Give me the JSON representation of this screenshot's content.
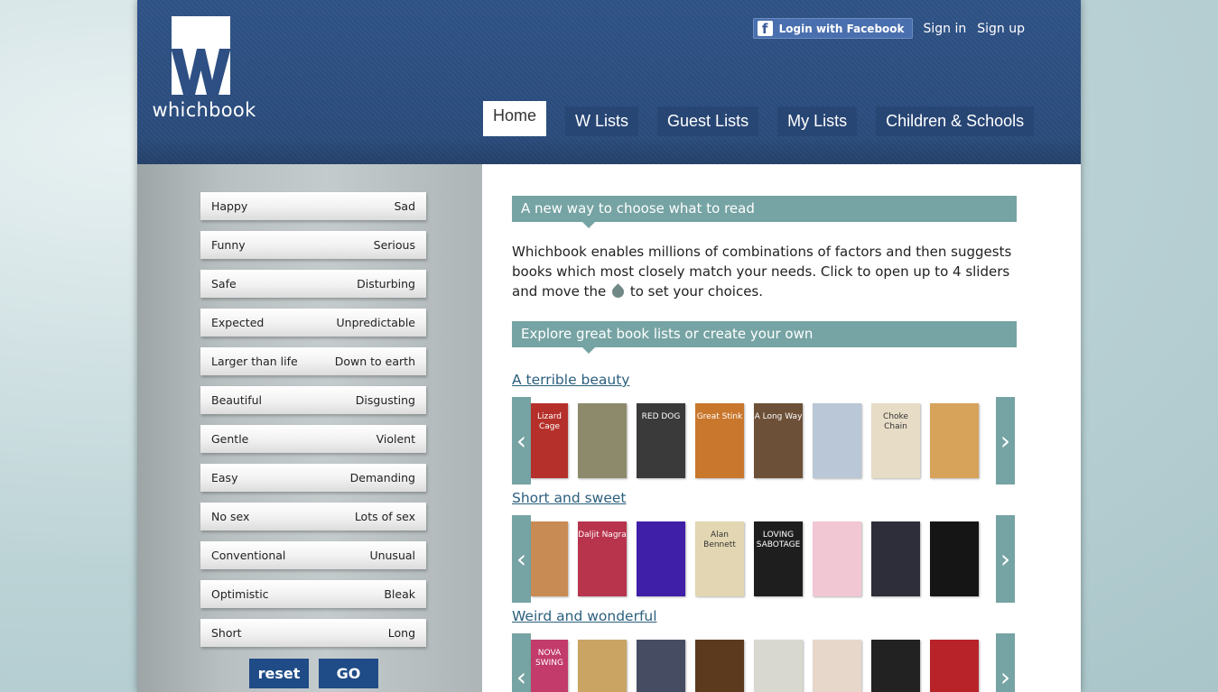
{
  "brand": {
    "name": "whichbook"
  },
  "auth": {
    "facebook": "Login with Facebook",
    "signin": "Sign in",
    "signup": "Sign up"
  },
  "nav": [
    {
      "label": "Home",
      "active": true
    },
    {
      "label": "W Lists"
    },
    {
      "label": "Guest Lists"
    },
    {
      "label": "My Lists"
    },
    {
      "label": "Children & Schools"
    }
  ],
  "sliders": [
    {
      "left": "Happy",
      "right": "Sad"
    },
    {
      "left": "Funny",
      "right": "Serious"
    },
    {
      "left": "Safe",
      "right": "Disturbing"
    },
    {
      "left": "Expected",
      "right": "Unpredictable"
    },
    {
      "left": "Larger than life",
      "right": "Down to earth"
    },
    {
      "left": "Beautiful",
      "right": "Disgusting"
    },
    {
      "left": "Gentle",
      "right": "Violent"
    },
    {
      "left": "Easy",
      "right": "Demanding"
    },
    {
      "left": "No sex",
      "right": "Lots of sex"
    },
    {
      "left": "Conventional",
      "right": "Unusual"
    },
    {
      "left": "Optimistic",
      "right": "Bleak"
    },
    {
      "left": "Short",
      "right": "Long"
    }
  ],
  "buttons": {
    "reset": "reset",
    "go": "GO"
  },
  "main": {
    "banner1": "A new way to choose what to read",
    "intro_before": "Whichbook enables millions of combinations of factors and then suggests books which most closely match your needs. Click to open up to 4 sliders and move the",
    "intro_after": "to set your choices.",
    "banner2": "Explore great book lists or create your own",
    "lists": [
      {
        "title": "A terrible beauty",
        "covers": [
          {
            "text": "Lizard Cage",
            "color": "#b5302a"
          },
          {
            "text": "",
            "color": "#8d8a6c"
          },
          {
            "text": "RED DOG",
            "color": "#3b3a3a"
          },
          {
            "text": "Great Stink",
            "color": "#c9772c"
          },
          {
            "text": "A Long Way",
            "color": "#6d5038"
          },
          {
            "text": "",
            "color": "#b9c7d6"
          },
          {
            "text": "Choke Chain",
            "color": "#e7dcc6"
          },
          {
            "text": "",
            "color": "#d7a25a"
          }
        ]
      },
      {
        "title": "Short and sweet",
        "covers": [
          {
            "text": "",
            "color": "#c98b54"
          },
          {
            "text": "Daljit Nagra",
            "color": "#b8344d"
          },
          {
            "text": "",
            "color": "#3f1ea8"
          },
          {
            "text": "Alan Bennett",
            "color": "#e2d7b2"
          },
          {
            "text": "LOVING SABOTAGE",
            "color": "#1e1e1e"
          },
          {
            "text": "",
            "color": "#f2c7d4"
          },
          {
            "text": "",
            "color": "#2e2e3a"
          },
          {
            "text": "",
            "color": "#151515"
          }
        ]
      },
      {
        "title": "Weird and wonderful",
        "covers": [
          {
            "text": "NOVA SWING",
            "color": "#c23b6a"
          },
          {
            "text": "",
            "color": "#c9a463"
          },
          {
            "text": "",
            "color": "#464d63"
          },
          {
            "text": "",
            "color": "#5b3a1e"
          },
          {
            "text": "",
            "color": "#d8d8d0"
          },
          {
            "text": "",
            "color": "#e7d7cb"
          },
          {
            "text": "",
            "color": "#222"
          },
          {
            "text": "",
            "color": "#b8232a"
          }
        ]
      }
    ]
  },
  "colors": {
    "header": "#2b4d7e",
    "accent": "#76a3a3",
    "button": "#1f4b87"
  }
}
